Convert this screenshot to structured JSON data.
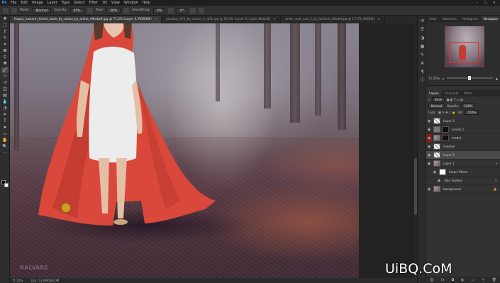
{
  "menubar": {
    "app_icon": "Ps",
    "items": [
      "File",
      "Edit",
      "Image",
      "Layer",
      "Type",
      "Select",
      "Filter",
      "3D",
      "View",
      "Window",
      "Help"
    ]
  },
  "options": {
    "mode_label": "Mode:",
    "mode_value": "Normal",
    "opacity_label": "Opacity:",
    "opacity_value": "65%",
    "flow_label": "Flow:",
    "flow_value": "30%",
    "smoothing_label": "Smoothing:",
    "smoothing_value": "0%",
    "angle_value": "0°"
  },
  "tabs": [
    {
      "label": "Happy_autumn_forest_stock_by_aisloo_by_arkita_d9jv4p9.jpg @ 71.2% (Layer 2, RGB/8#)",
      "active": true
    },
    {
      "label": "pixabay_071_by_aisloo_1_rb5jr.jpg @ 56.4% (Layer 0, Layer Mask/8)",
      "active": false
    },
    {
      "label": "arctic_wolf_cub_2_by_fonfand_d6z4htjpg @ 17.5% (RGB/8)",
      "active": false
    }
  ],
  "status": {
    "zoom": "71.25%",
    "doc": "Doc: 12.6M/183.0M"
  },
  "canvas": {
    "watermark": "RALVARE"
  },
  "navigator": {
    "tabs": [
      "Color",
      "Swatches",
      "Histogram",
      "Navigator"
    ],
    "zoom": "71.25%"
  },
  "layers_panel": {
    "tabs": [
      "Layers",
      "Channels",
      "Paths"
    ],
    "kind_label": "Kind",
    "blend_mode": "Normal",
    "opacity_label": "Opacity:",
    "opacity_value": "100%",
    "lock_label": "Lock:",
    "fill_label": "Fill:",
    "fill_value": "100%",
    "layers": [
      {
        "name": "Layer 3",
        "thumb": "tp",
        "active": false,
        "eye_red": false
      },
      {
        "name": "Levels 1",
        "thumb": "mask",
        "active": false,
        "eye_red": false
      },
      {
        "name": "model",
        "thumb": "img",
        "active": false,
        "eye_red": true
      },
      {
        "name": "shadow",
        "thumb": "tp",
        "active": false,
        "eye_red": false
      },
      {
        "name": "Layer 2",
        "thumb": "tp",
        "active": true,
        "eye_red": false
      },
      {
        "name": "Layer 1",
        "thumb": "img",
        "active": false,
        "eye_red": false
      },
      {
        "name": "Smart Filters",
        "thumb": "mask",
        "active": false,
        "eye_red": false
      },
      {
        "name": "Blur Gallery",
        "thumb": "none",
        "active": false,
        "eye_red": false
      },
      {
        "name": "background",
        "thumb": "img",
        "active": false,
        "eye_red": false
      }
    ]
  },
  "watermark_brand": "UiBQ.CoM"
}
